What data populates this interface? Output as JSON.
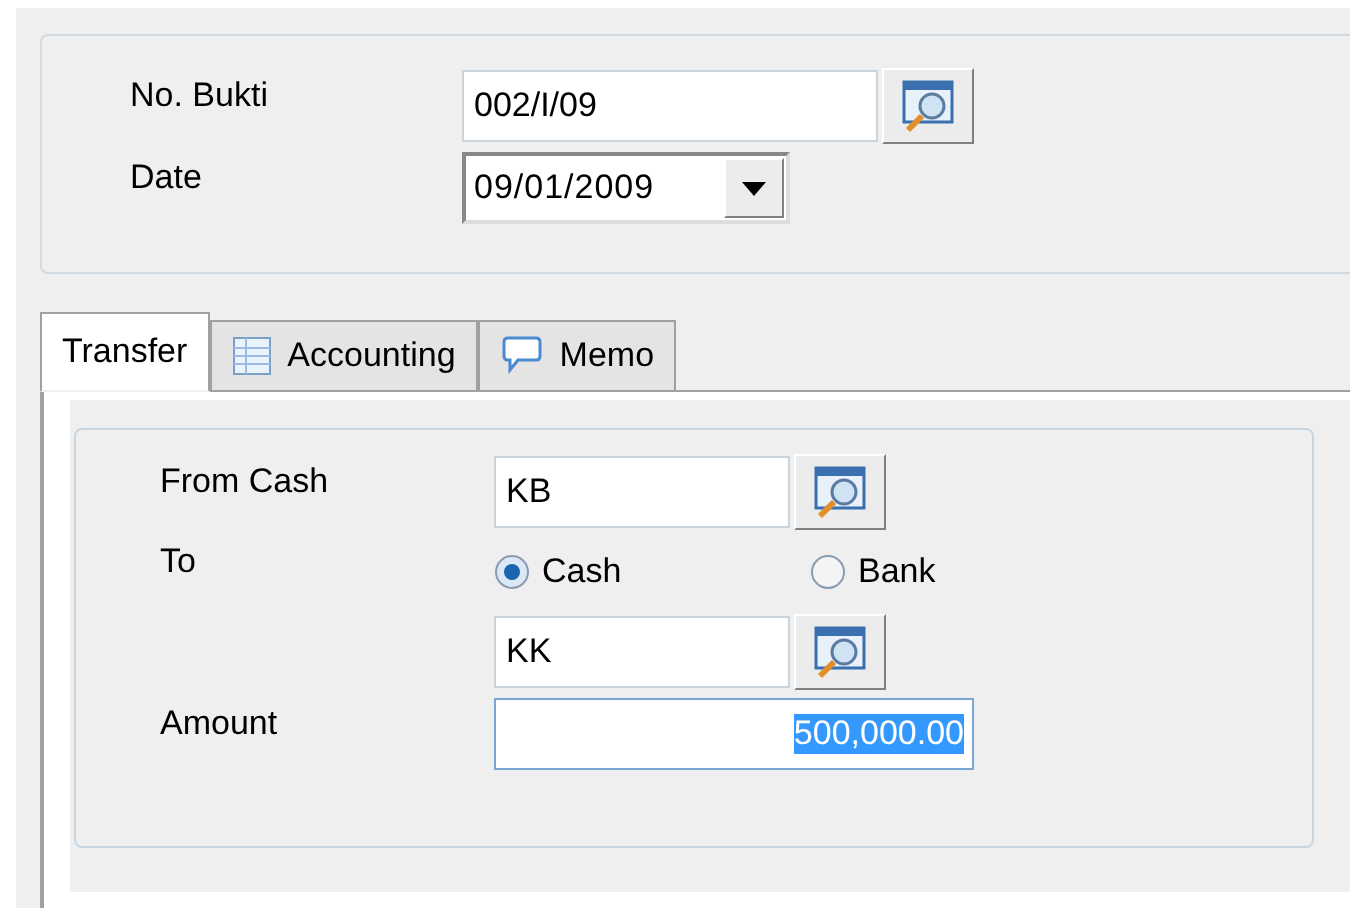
{
  "header": {
    "fields": [
      {
        "label": "No. Bukti",
        "kind": "lookup",
        "value": "002/I/09"
      },
      {
        "label": "Date",
        "kind": "date",
        "value": "09/01/2009"
      }
    ]
  },
  "tabs": [
    {
      "label": "Transfer",
      "kind": "plain",
      "selected": true
    },
    {
      "label": "Accounting",
      "kind": "table",
      "selected": false
    },
    {
      "label": "Memo",
      "kind": "note",
      "selected": false
    }
  ],
  "transfer": {
    "from_label": "From Cash",
    "from_value": "KB",
    "to_label": "To",
    "options": [
      {
        "label": "Cash",
        "selected": true
      },
      {
        "label": "Bank",
        "selected": false
      }
    ],
    "to_value": "KK",
    "amount_label": "Amount",
    "amount_value": "500,000.00",
    "amount_selected": true
  }
}
